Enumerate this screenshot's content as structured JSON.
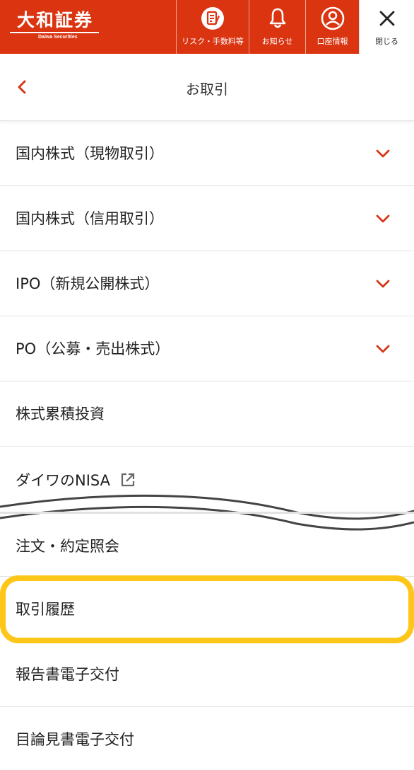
{
  "header": {
    "logo_text": "大和証券",
    "logo_sub": "Daiwa Securities",
    "buttons": {
      "risk_label": "リスク・手数料等",
      "notice_label": "お知らせ",
      "account_label": "口座情報",
      "close_label": "閉じる"
    }
  },
  "titlebar": {
    "title": "お取引"
  },
  "menu": {
    "items": [
      {
        "label": "国内株式（現物取引）"
      },
      {
        "label": "国内株式（信用取引）"
      },
      {
        "label": "IPO（新規公開株式）"
      },
      {
        "label": "PO（公募・売出株式）"
      },
      {
        "label": "株式累積投資"
      },
      {
        "label": "ダイワのNISA"
      },
      {
        "label": "注文・約定照会"
      },
      {
        "label": "取引履歴"
      },
      {
        "label": "報告書電子交付"
      },
      {
        "label": "目論見書電子交付"
      }
    ]
  },
  "icons": {
    "risk": "document-icon",
    "notice": "bell-icon",
    "account": "user-circle-icon",
    "close": "close-icon",
    "back": "chevron-left-icon",
    "expand": "chevron-down-icon",
    "external": "external-link-icon"
  },
  "colors": {
    "brand": "#da3411",
    "highlight": "#ffc61a",
    "chevron": "#d6391a"
  }
}
